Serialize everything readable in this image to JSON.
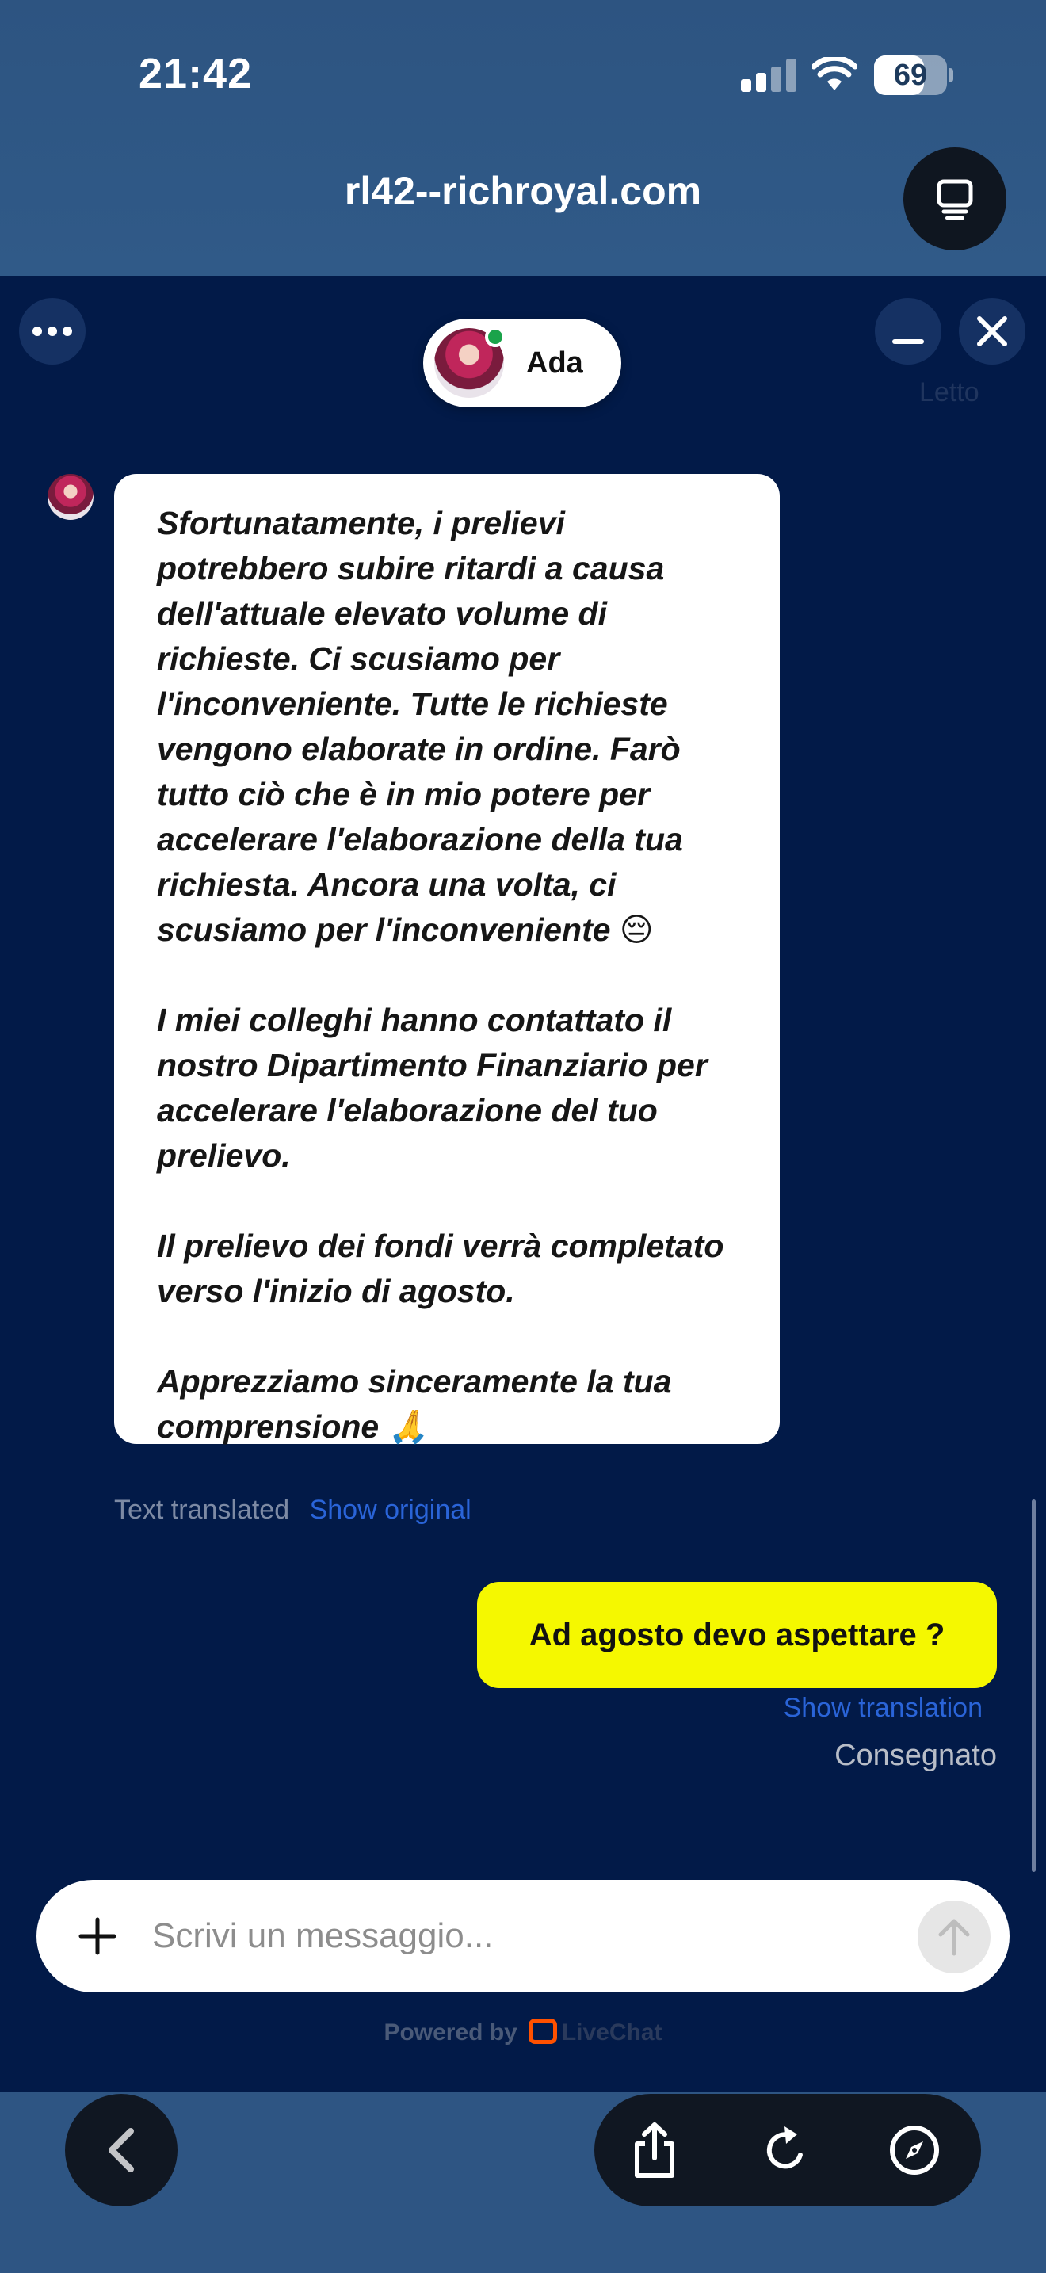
{
  "status_bar": {
    "time": "21:42",
    "battery_level": "69",
    "battery_fraction": 0.69
  },
  "browser": {
    "url": "rl42--richroyal.com",
    "icons": {
      "tabs": "tabs-icon",
      "back": "chevron-left-icon",
      "share": "share-icon",
      "reload": "reload-icon",
      "compass": "compass-icon"
    }
  },
  "chat": {
    "agent_name": "Ada",
    "agent_status_color": "#1aa34a",
    "read_receipt_ghost": "Letto",
    "agent_message": {
      "paragraphs": [
        "Sfortunatamente, i prelievi potrebbero subire ritardi a causa dell'attuale elevato volume di richieste. Ci scusiamo per l'inconveniente. Tutte le richieste vengono elaborate in ordine. Farò tutto ciò che è in mio potere per accelerare l'elaborazione della tua richiesta. Ancora una volta, ci scusiamo per l'inconveniente 😔",
        "I miei colleghi hanno contattato il nostro Dipartimento Finanziario per accelerare l'elaborazione del tuo prelievo.",
        "Il prelievo dei fondi verrà completato verso l'inizio di agosto.",
        "Apprezziamo sinceramente la tua comprensione 🙏"
      ],
      "translated_label": "Text translated",
      "show_original_label": "Show original"
    },
    "user_message": {
      "text": "Ad agosto devo aspettare ?",
      "show_translation_label": "Show translation",
      "status": "Consegnato"
    },
    "composer": {
      "placeholder": "Scrivi un messaggio..."
    },
    "powered_by": {
      "label": "Powered by",
      "brand": "LiveChat"
    },
    "colors": {
      "background": "#021a48",
      "user_bubble": "#f5f800",
      "link": "#2a64d8"
    }
  }
}
